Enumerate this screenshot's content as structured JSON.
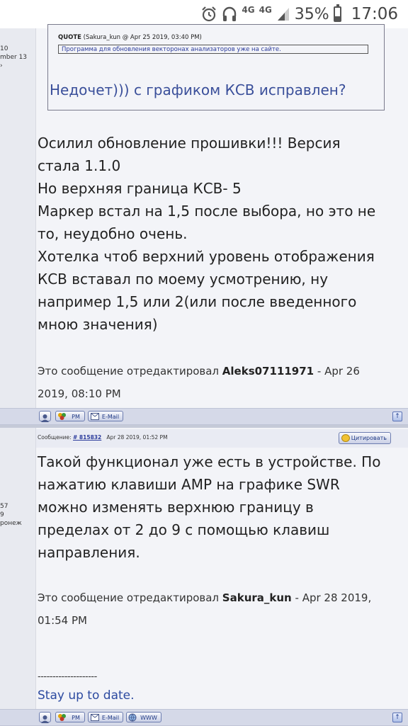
{
  "status_bar": {
    "network_1": "4G",
    "network_2": "4G",
    "battery": "35%",
    "battery_level": 0.35,
    "time": "17:06",
    "icons": [
      "alarm-icon",
      "headset-icon",
      "signal-icon",
      "battery-icon"
    ]
  },
  "left_column": {
    "post1_lines": [
      "10",
      "mber 13",
      "›"
    ],
    "post2_lines": [
      "57",
      "9",
      "ронеж"
    ]
  },
  "post1": {
    "quote_top_fragment": "",
    "quote_header_label": "QUOTE",
    "quote_header_meta": "(Sakura_kun @ Apr 25 2019, 03:40 PM)",
    "quote_inner_text": "Программа для обновления векторонах анализаторов уже на сайте.",
    "quote_follow": "Недочет))) с графиком КСВ исправлен?",
    "body_lines": [
      "Осилил обновление прошивки!!! Версия",
      "стала 1.1.0",
      "Но верхняя граница КСВ- 5",
      "Маркер встал на 1,5 после выбора, но это не",
      "то, неудобно очень.",
      "Хотелка чтоб верхний уровень отображения",
      "КСВ вставал по моему усмотрению, ну",
      "например 1,5 или 2(или после введенного",
      "мною значения)"
    ],
    "edit_prefix": "Это сообщение отредактировал",
    "edit_user": "Aleks07111971",
    "edit_date_1": "- Apr 26",
    "edit_date_2": "2019, 08:10 PM"
  },
  "bar1": {
    "pm": "PM",
    "email": "E-Mail",
    "up": "↑"
  },
  "post2_header": {
    "label": "Сообщение:",
    "number": "# 815832",
    "date": "Apr 28 2019, 01:52 PM",
    "cite": "Цитировать"
  },
  "post2": {
    "body_lines": [
      "Такой функционал уже есть в устройстве. По",
      "нажатию клавиши AMP на графике SWR",
      "можно изменять верхнюю границу в",
      "пределах от 2 до 9 с помощью клавиш",
      "направления."
    ],
    "edit_prefix": "Это сообщение отредактировал",
    "edit_user": "Sakura_kun",
    "edit_date_1": "- Apr 28 2019,",
    "edit_date_2": "01:54 PM",
    "signature_line": "--------------------",
    "signature_text": "Stay up to date."
  },
  "bar2": {
    "pm": "PM",
    "email": "E-Mail",
    "www": "WWW",
    "up": "↑"
  }
}
